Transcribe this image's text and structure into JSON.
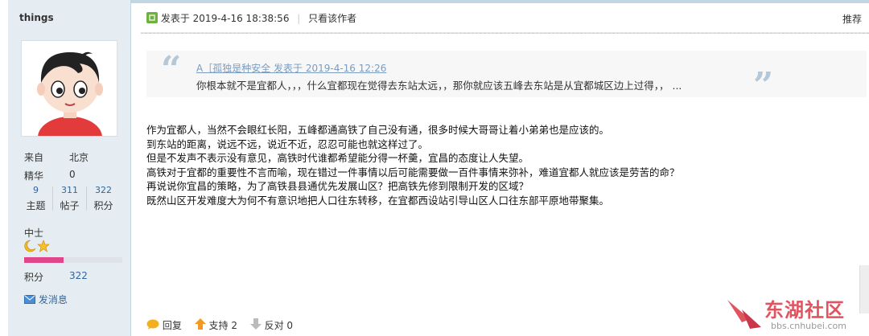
{
  "author": {
    "username": "things",
    "from_label": "来自",
    "from_value": "北京",
    "essence_label": "精华",
    "essence_value": "0",
    "stats": [
      {
        "value": "9",
        "label": "主题"
      },
      {
        "value": "311",
        "label": "帖子"
      },
      {
        "value": "322",
        "label": "积分"
      }
    ],
    "rank": "中士",
    "level_progress": 0.4,
    "points_label": "积分",
    "points_value": "322",
    "message_label": "发消息"
  },
  "post": {
    "posted_at": "发表于 2019-4-16 18:38:56",
    "only_author": "只看该作者",
    "recommend": "推荐",
    "quote_header": "A［孤独是种安全 发表于 2019-4-16 12:26",
    "quote_body": "你根本就不是宜都人，，，什么宜都现在觉得去东站太远，，那你就应该五峰去东站是从宜都城区边上过得，， ...",
    "lines": [
      "作为宜都人，当然不会眼红长阳，五峰都通高铁了自己没有通，很多时候大哥哥让着小弟弟也是应该的。",
      "到东站的距离，说远不远，说近不近，忍忍可能也就这样过了。",
      "但是不发声不表示没有意见，高铁时代谁都希望能分得一杯羹，宜昌的态度让人失望。",
      "高铁对于宜都的重要性不言而喻，现在错过一件事情以后可能需要做一百件事情来弥补，难道宜都人就应该是劳苦的命？",
      "再说说你宜昌的策略，为了高铁县县通优先发展山区？把高铁先修到限制开发的区域？",
      "既然山区开发难度大为何不有意识地把人口往东转移，在宜都西设站引导山区人口往东部平原地带聚集。"
    ]
  },
  "footer": {
    "reply": "回复",
    "support": "支持 2",
    "oppose": "反对 0"
  },
  "watermark": {
    "name": "东湖社区",
    "url": "bbs.cnhubei.com"
  }
}
